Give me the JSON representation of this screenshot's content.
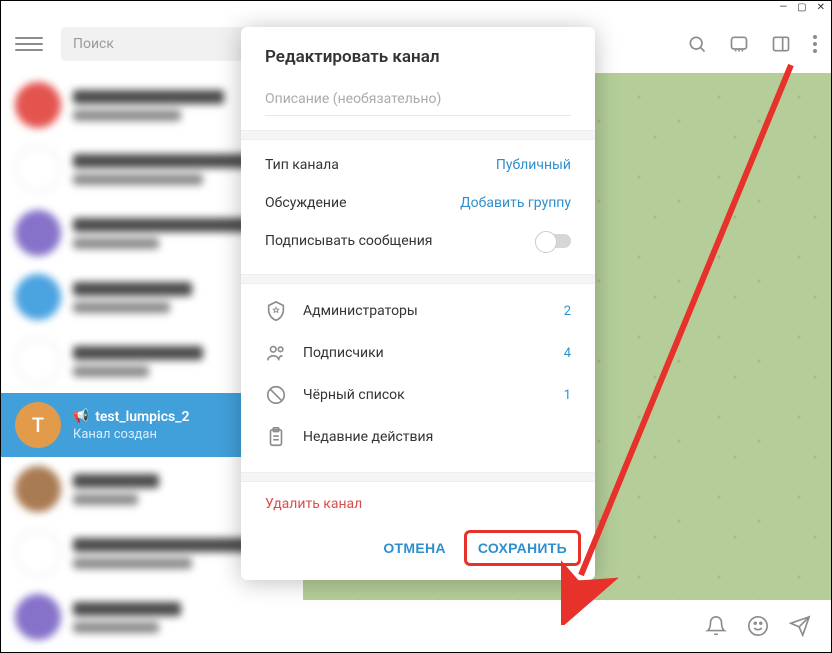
{
  "window": {
    "min": "—",
    "max": "▢",
    "close": "✕"
  },
  "search": {
    "placeholder": "Поиск"
  },
  "selected_chat": {
    "letter": "T",
    "name": "test_lumpics_2",
    "sub": "Канал создан"
  },
  "modal": {
    "title": "Редактировать канал",
    "desc_placeholder": "Описание (необязательно)",
    "type_label": "Тип канала",
    "type_value": "Публичный",
    "discussion_label": "Обсуждение",
    "discussion_value": "Добавить группу",
    "sign_label": "Подписывать сообщения",
    "admins_label": "Администраторы",
    "admins_count": "2",
    "subs_label": "Подписчики",
    "subs_count": "4",
    "blacklist_label": "Чёрный список",
    "blacklist_count": "1",
    "recent_label": "Недавние действия",
    "delete": "Удалить канал",
    "cancel": "ОТМЕНА",
    "save": "СОХРАНИТЬ"
  }
}
